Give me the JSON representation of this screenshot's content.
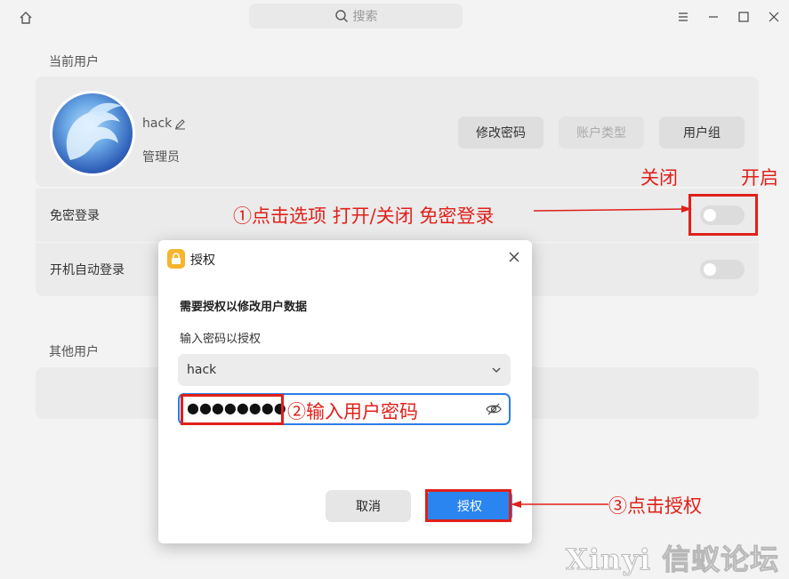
{
  "search": {
    "label": "搜索"
  },
  "sections": {
    "current_user": "当前用户",
    "other_users": "其他用户"
  },
  "user": {
    "name": "hack",
    "role": "管理员",
    "buttons": {
      "change_password": "修改密码",
      "account_type": "账户类型",
      "user_group": "用户组"
    }
  },
  "settings": {
    "passwordless_login": {
      "label": "免密登录",
      "enabled": false
    },
    "auto_login": {
      "label": "开机自动登录",
      "enabled": false
    }
  },
  "annotations": {
    "off": "关闭",
    "on": "开启",
    "step1": "①点击选项 打开/关闭 免密登录",
    "step2": "②输入用户密码",
    "step3": "③点击授权"
  },
  "dialog": {
    "title": "授权",
    "heading": "需要授权以修改用户数据",
    "password_label": "输入密码以授权",
    "selected_user": "hack",
    "password_mask": "●●●●●●●●",
    "cancel": "取消",
    "authorize": "授权"
  },
  "watermark": "Xinyi 信蚁论坛",
  "colors": {
    "accent": "#2a85f0",
    "annotation": "#e0201a",
    "card_bg": "#ebebeb",
    "lock_icon": "#f5b52c"
  }
}
